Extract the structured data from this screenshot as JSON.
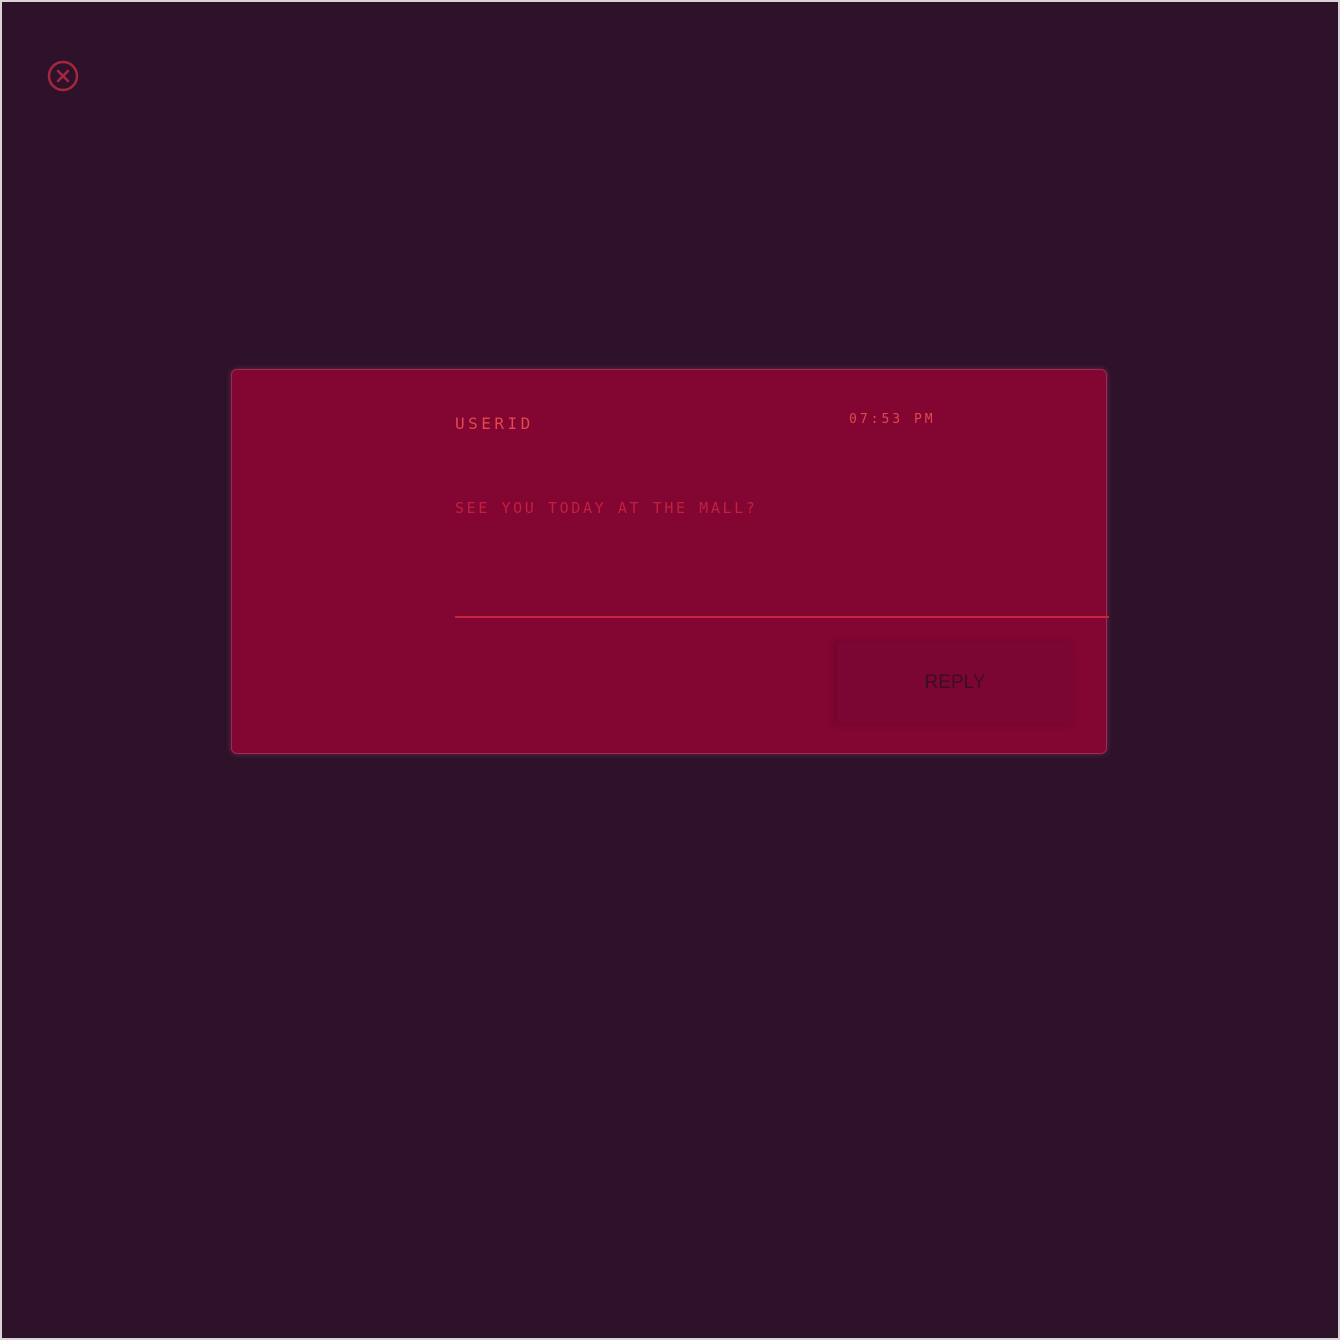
{
  "close_button": {
    "icon": "close-circle-icon",
    "color": "#a3283f"
  },
  "message_card": {
    "user_id": "USERID",
    "timestamp": "07:53 PM",
    "message": "SEE YOU TODAY AT THE MALL?",
    "reply_label": "REPLY"
  },
  "colors": {
    "background": "#2e1229",
    "card": "#820532",
    "accent": "#e0494f",
    "divider": "#c8243f",
    "reply_text": "#3a0d22"
  }
}
